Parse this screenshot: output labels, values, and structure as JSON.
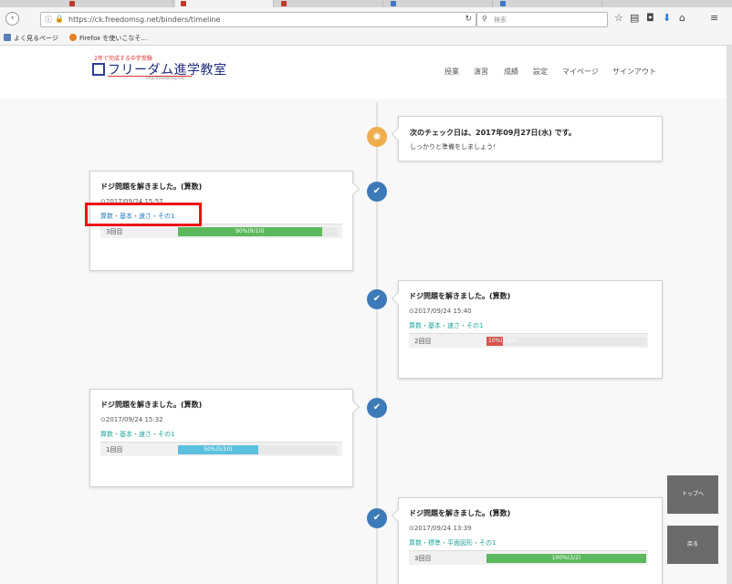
{
  "browser": {
    "tabs": [
      {
        "label": "",
        "icon": "red",
        "active": false
      },
      {
        "label": "",
        "icon": "red",
        "active": true
      },
      {
        "label": "",
        "icon": "red",
        "active": false
      },
      {
        "label": "",
        "icon": "blue",
        "active": false
      },
      {
        "label": "",
        "icon": "blue",
        "active": false
      }
    ],
    "url": "https://ck.freedomsg.net/binders/timeline",
    "search_placeholder": "検索",
    "bookmarks": [
      "よく見るページ",
      "Firefox を使いこなそ..."
    ]
  },
  "site": {
    "tagline": "2年で完成する中学受験",
    "name": "フリーダム進学教室",
    "sub_url": "http://freedomsg.net/",
    "nav": [
      "授業",
      "演習",
      "成績",
      "設定",
      "マイページ",
      "サインアウト"
    ]
  },
  "timeline": {
    "notice": {
      "title": "次のチェック日は、2017年09月27日(水) です。",
      "sub": "しっかりと準備をしましょう！"
    },
    "entries": [
      {
        "title": "ドジ問題を解きました。(算数)",
        "time": "2017/09/24 15:57",
        "link": "算数・基本・速さ・その1",
        "round": "3回目",
        "progress": 0.9,
        "progress_label": "90%(9/10)",
        "color": "#5cb85c"
      },
      {
        "title": "ドジ問題を解きました。(算数)",
        "time": "2017/09/24 15:40",
        "link": "算数・基本・速さ・その1",
        "round": "2回目",
        "progress": 0.1,
        "progress_label": "10%(1/10)",
        "color": "#d9534f"
      },
      {
        "title": "ドジ問題を解きました。(算数)",
        "time": "2017/09/24 15:32",
        "link": "算数・基本・速さ・その1",
        "round": "1回目",
        "progress": 0.5,
        "progress_label": "50%(5/10)",
        "color": "#5bc0de"
      },
      {
        "title": "ドジ問題を解きました。(算数)",
        "time": "2017/09/24 13:39",
        "link": "算数・標準・平面図形・その1",
        "round": "3回目",
        "progress": 1.0,
        "progress_label": "100%(2/2)",
        "color": "#5cb85c"
      }
    ]
  },
  "side_buttons": {
    "top": "トップへ",
    "back": "戻る"
  }
}
